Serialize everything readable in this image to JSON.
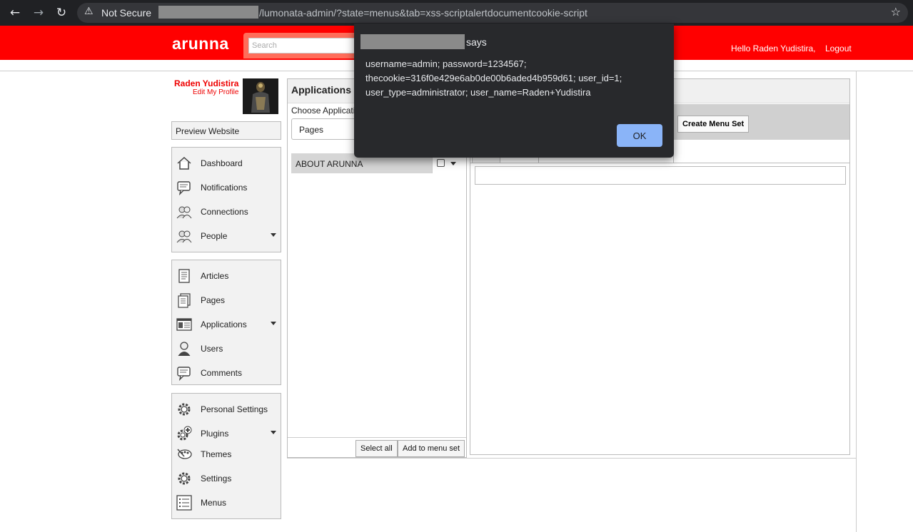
{
  "browser": {
    "security_label": "Not Secure",
    "url": "/lumonata-admin/?state=menus&tab=xss-scriptalertdocumentcookie-script"
  },
  "header": {
    "logo": "arunna",
    "search_placeholder": "Search",
    "greeting": "Hello Raden Yudistira,",
    "logout": "Logout"
  },
  "profile": {
    "name": "Raden Yudistira",
    "edit_link": "Edit My Profile"
  },
  "preview_label": "Preview Website",
  "sidebar": {
    "group1": [
      {
        "label": "Dashboard",
        "icon": "home-icon"
      },
      {
        "label": "Notifications",
        "icon": "speech-bubble-icon"
      },
      {
        "label": "Connections",
        "icon": "users-icon"
      },
      {
        "label": "People",
        "icon": "users-icon",
        "has_submenu": true
      }
    ],
    "group2": [
      {
        "label": "Articles",
        "icon": "document-icon"
      },
      {
        "label": "Pages",
        "icon": "pages-icon"
      },
      {
        "label": "Applications",
        "icon": "application-icon",
        "has_submenu": true
      },
      {
        "label": "Users",
        "icon": "user-icon"
      },
      {
        "label": "Comments",
        "icon": "comment-icon"
      }
    ],
    "group3": [
      {
        "label": "Personal Settings",
        "icon": "gear-icon"
      },
      {
        "label": "Plugins",
        "icon": "plugin-gear-icon",
        "has_submenu": true
      },
      {
        "label": "Themes",
        "icon": "palette-icon"
      },
      {
        "label": "Settings",
        "icon": "gear-icon"
      },
      {
        "label": "Menus",
        "icon": "list-icon"
      }
    ]
  },
  "applications": {
    "title": "Applications",
    "choose_label": "Choose Applicati",
    "selected_app": "Pages",
    "items": [
      {
        "label": "ABOUT ARUNNA"
      }
    ],
    "select_all": "Select all",
    "add_to_menu_set": "Add to menu set"
  },
  "menu_set": {
    "create_button": "Create Menu Set"
  },
  "alert": {
    "says": "says",
    "message": "username=admin; password=1234567; thecookie=316f0e429e6ab0de00b6aded4b959d61; user_id=1; user_type=administrator; user_name=Raden+Yudistira",
    "ok": "OK"
  },
  "colors": {
    "header_red": "#ff0000",
    "alert_button": "#8ab4f8"
  }
}
